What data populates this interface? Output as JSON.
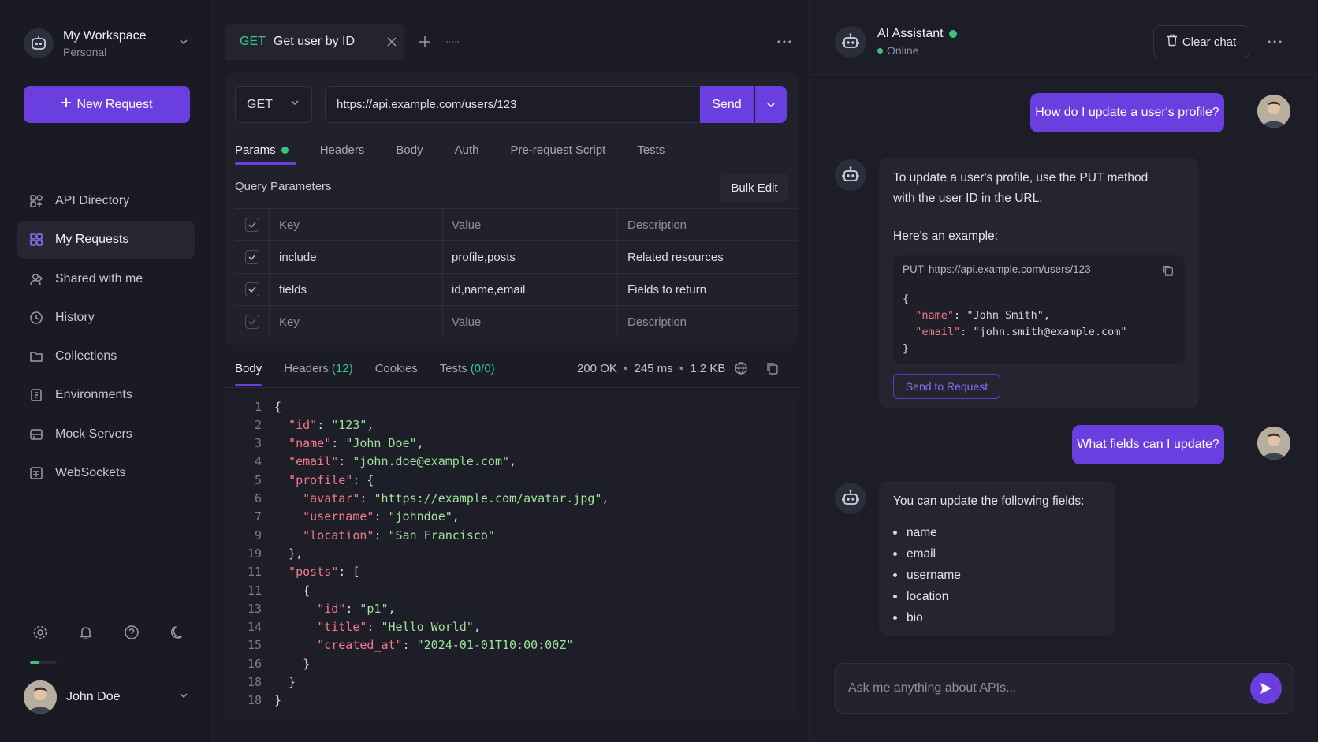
{
  "sidebar": {
    "workspace_name": "My Workspace",
    "workspace_sub": "Personal",
    "new_request": "New Request",
    "items": [
      {
        "label": "API Directory",
        "icon": "directory-icon"
      },
      {
        "label": "My Requests",
        "icon": "grid-icon",
        "active": true
      },
      {
        "label": "Shared with me",
        "icon": "users-icon"
      },
      {
        "label": "History",
        "icon": "clock-icon"
      },
      {
        "label": "Collections",
        "icon": "folder-icon"
      },
      {
        "label": "Environments",
        "icon": "environment-icon"
      },
      {
        "label": "Mock Servers",
        "icon": "server-icon"
      },
      {
        "label": "WebSockets",
        "icon": "websocket-icon"
      }
    ],
    "user_name": "John Doe",
    "progress": 0.35
  },
  "request_tab": {
    "method": "GET",
    "title": "Get user by ID"
  },
  "request": {
    "method": "GET",
    "url": "https://api.example.com/users/123",
    "send_label": "Send",
    "tabs": [
      "Params",
      "Headers",
      "Body",
      "Auth",
      "Pre-request Script",
      "Tests"
    ],
    "query_label": "Query Parameters",
    "bulk_edit": "Bulk Edit",
    "table_headers": [
      "Key",
      "Value",
      "Description"
    ],
    "params": [
      {
        "key": "include",
        "value": "profile,posts",
        "description": "Related resources"
      },
      {
        "key": "fields",
        "value": "id,name,email",
        "description": "Fields to return"
      }
    ],
    "placeholder_row": [
      "Key",
      "Value",
      "Description"
    ]
  },
  "response": {
    "tabs": {
      "body": "Body",
      "headers": "Headers",
      "headers_count": "(12)",
      "cookies": "Cookies",
      "tests": "Tests",
      "tests_count": "(0/0)"
    },
    "status": "200 OK",
    "time": "245 ms",
    "size": "1.2 KB",
    "sep": "•",
    "lines": [
      {
        "n": "1",
        "t": "{"
      },
      {
        "n": "2",
        "t": "  \"id\": \"123\","
      },
      {
        "n": "3",
        "t": "  \"name\": \"John Doe\","
      },
      {
        "n": "4",
        "t": "  \"email\": \"john.doe@example.com\","
      },
      {
        "n": "5",
        "t": "  \"profile\": {"
      },
      {
        "n": "6",
        "t": "    \"avatar\": \"https://example.com/avatar.jpg\","
      },
      {
        "n": "7",
        "t": "    \"username\": \"johndoe\","
      },
      {
        "n": "9",
        "t": "    \"location\": \"San Francisco\""
      },
      {
        "n": "19",
        "t": "  },"
      },
      {
        "n": "11",
        "t": "  \"posts\": ["
      },
      {
        "n": "11",
        "t": "    {"
      },
      {
        "n": "13",
        "t": "      \"id\": \"p1\","
      },
      {
        "n": "14",
        "t": "      \"title\": \"Hello World\","
      },
      {
        "n": "15",
        "t": "      \"created_at\": \"2024-01-01T10:00:00Z\""
      },
      {
        "n": "16",
        "t": "    }"
      },
      {
        "n": "18",
        "t": "  }"
      },
      {
        "n": "18",
        "t": "}"
      }
    ]
  },
  "assistant": {
    "name": "AI Assistant",
    "status": "Online",
    "clear_chat": "Clear chat",
    "q1": "How do I update a user's profile?",
    "a1_line1": "To update a user's profile, use the PUT method",
    "a1_line2": "with the user ID in the URL.",
    "a1_example": "Here's an example:",
    "code_method": "PUT",
    "code_url": "https://api.example.com/users/123",
    "code_lines": [
      "{",
      "  \"name\": \"John Smith\",",
      "  \"email\": \"john.smith@example.com\"",
      "}"
    ],
    "send_to_request": "Send to Request",
    "q2": "What fields can I update?",
    "a2_intro": "You can update the following fields:",
    "fields": [
      "name",
      "email",
      "username",
      "location",
      "bio"
    ],
    "input_placeholder": "Ask me anything about APIs..."
  },
  "colors": {
    "accent": "#6b3fdf",
    "success": "#3bc47a",
    "get_method": "#36c989"
  }
}
